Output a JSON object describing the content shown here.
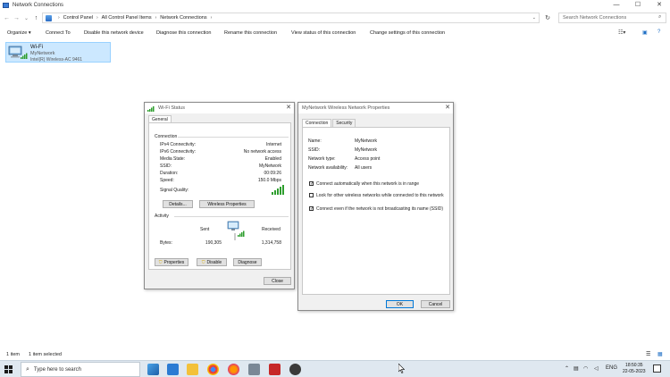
{
  "window": {
    "title": "Network Connections",
    "minimize": "—",
    "maximize": "☐",
    "close": "✕"
  },
  "nav": {
    "back": "←",
    "forward": "→",
    "recent": "⌄",
    "up": "↑",
    "refresh": "↻",
    "search_icon": "⌕"
  },
  "address": {
    "crumbs": [
      "Control Panel",
      "All Control Panel Items",
      "Network Connections"
    ],
    "separator": "›"
  },
  "search": {
    "placeholder": "Search Network Connections"
  },
  "commands": [
    "Organize ▾",
    "Connect To",
    "Disable this network device",
    "Diagnose this connection",
    "Rename this connection",
    "View status of this connection",
    "Change settings of this connection"
  ],
  "adapter": {
    "name": "Wi-Fi",
    "network": "MyNetwork",
    "device": "Intel(R) Wireless-AC 9461"
  },
  "statusbar": {
    "count": "1 item",
    "selected": "1 item selected"
  },
  "wifi_status": {
    "title": "Wi-Fi Status",
    "tab": "General",
    "connection_header": "Connection",
    "rows": [
      {
        "label": "IPv4 Connectivity:",
        "value": "Internet"
      },
      {
        "label": "IPv6 Connectivity:",
        "value": "No network access"
      },
      {
        "label": "Media State:",
        "value": "Enabled"
      },
      {
        "label": "SSID:",
        "value": "MyNetwork"
      },
      {
        "label": "Duration:",
        "value": "00:09:26"
      },
      {
        "label": "Speed:",
        "value": "150.0 Mbps"
      }
    ],
    "signal_label": "Signal Quality:",
    "signal_bars": 5,
    "details_btn": "Details...",
    "wireless_props_btn": "Wireless Properties",
    "activity_header": "Activity",
    "sent_label": "Sent",
    "received_label": "Received",
    "bytes_label": "Bytes:",
    "bytes_sent": "190,305",
    "bytes_received": "1,314,758",
    "properties_btn": "Properties",
    "disable_btn": "Disable",
    "diagnose_btn": "Diagnose",
    "close_btn": "Close"
  },
  "wireless_props": {
    "title": "MyNetwork Wireless Network Properties",
    "tabs": [
      "Connection",
      "Security"
    ],
    "rows": [
      {
        "label": "Name:",
        "value": "MyNetwork"
      },
      {
        "label": "SSID:",
        "value": "MyNetwork"
      },
      {
        "label": "Network type:",
        "value": "Access point"
      },
      {
        "label": "Network availability:",
        "value": "All users"
      }
    ],
    "options": [
      {
        "text": "Connect automatically when this network is in range",
        "checked": true
      },
      {
        "text": "Look for other wireless networks while connected to this network",
        "checked": false
      },
      {
        "text": "Connect even if the network is not broadcasting its name (SSID)",
        "checked": true
      }
    ],
    "ok_btn": "OK",
    "cancel_btn": "Cancel"
  },
  "taskbar": {
    "search_placeholder": "Type here to search",
    "language": "ENG",
    "time": "18:50:35",
    "date": "22-05-2023"
  },
  "colors": {
    "selection": "#cce8ff",
    "accent": "#0078d7",
    "taskbar": "#dfe8f0",
    "signal": "#2e9e2e"
  }
}
